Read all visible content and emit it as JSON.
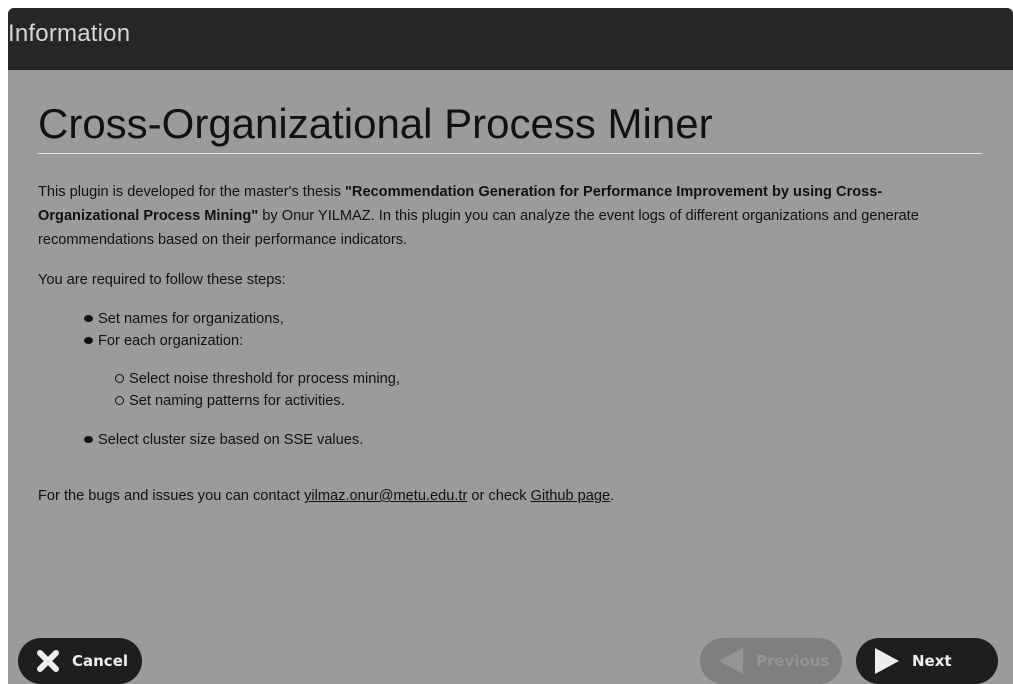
{
  "window": {
    "title": "Information"
  },
  "main": {
    "heading": "Cross-Organizational Process Miner",
    "intro": {
      "text1": "This plugin is developed for the master's thesis ",
      "thesis_title": "\"Recommendation Generation for Performance Improvement by using Cross-Organizational Process Mining\"",
      "text2": " by Onur YILMAZ. In this plugin you can analyze the event logs of different organizations and generate recommendations based on their performance indicators."
    },
    "steps_intro": "You are required to follow these steps:",
    "steps": [
      "Set names for organizations,",
      "For each organization:",
      "Select cluster size based on SSE values."
    ],
    "substeps": [
      "Select noise threshold for process mining,",
      "Set naming patterns for activities."
    ],
    "contact": {
      "prefix": "For the bugs and issues you can contact ",
      "email": "yilmaz.onur@metu.edu.tr",
      "middle": " or check ",
      "github": "Github page",
      "suffix": "."
    }
  },
  "footer": {
    "cancel_label": "Cancel",
    "previous_label": "Previous",
    "next_label": "Next"
  },
  "colors": {
    "titlebar": "#262626",
    "panel": "#9b9b9b",
    "button": "#1e1e1e",
    "button_disabled": "#7f7f7f"
  },
  "icons": {
    "cancel": "close-x-icon",
    "previous": "triangle-left-icon",
    "next": "triangle-right-icon"
  }
}
